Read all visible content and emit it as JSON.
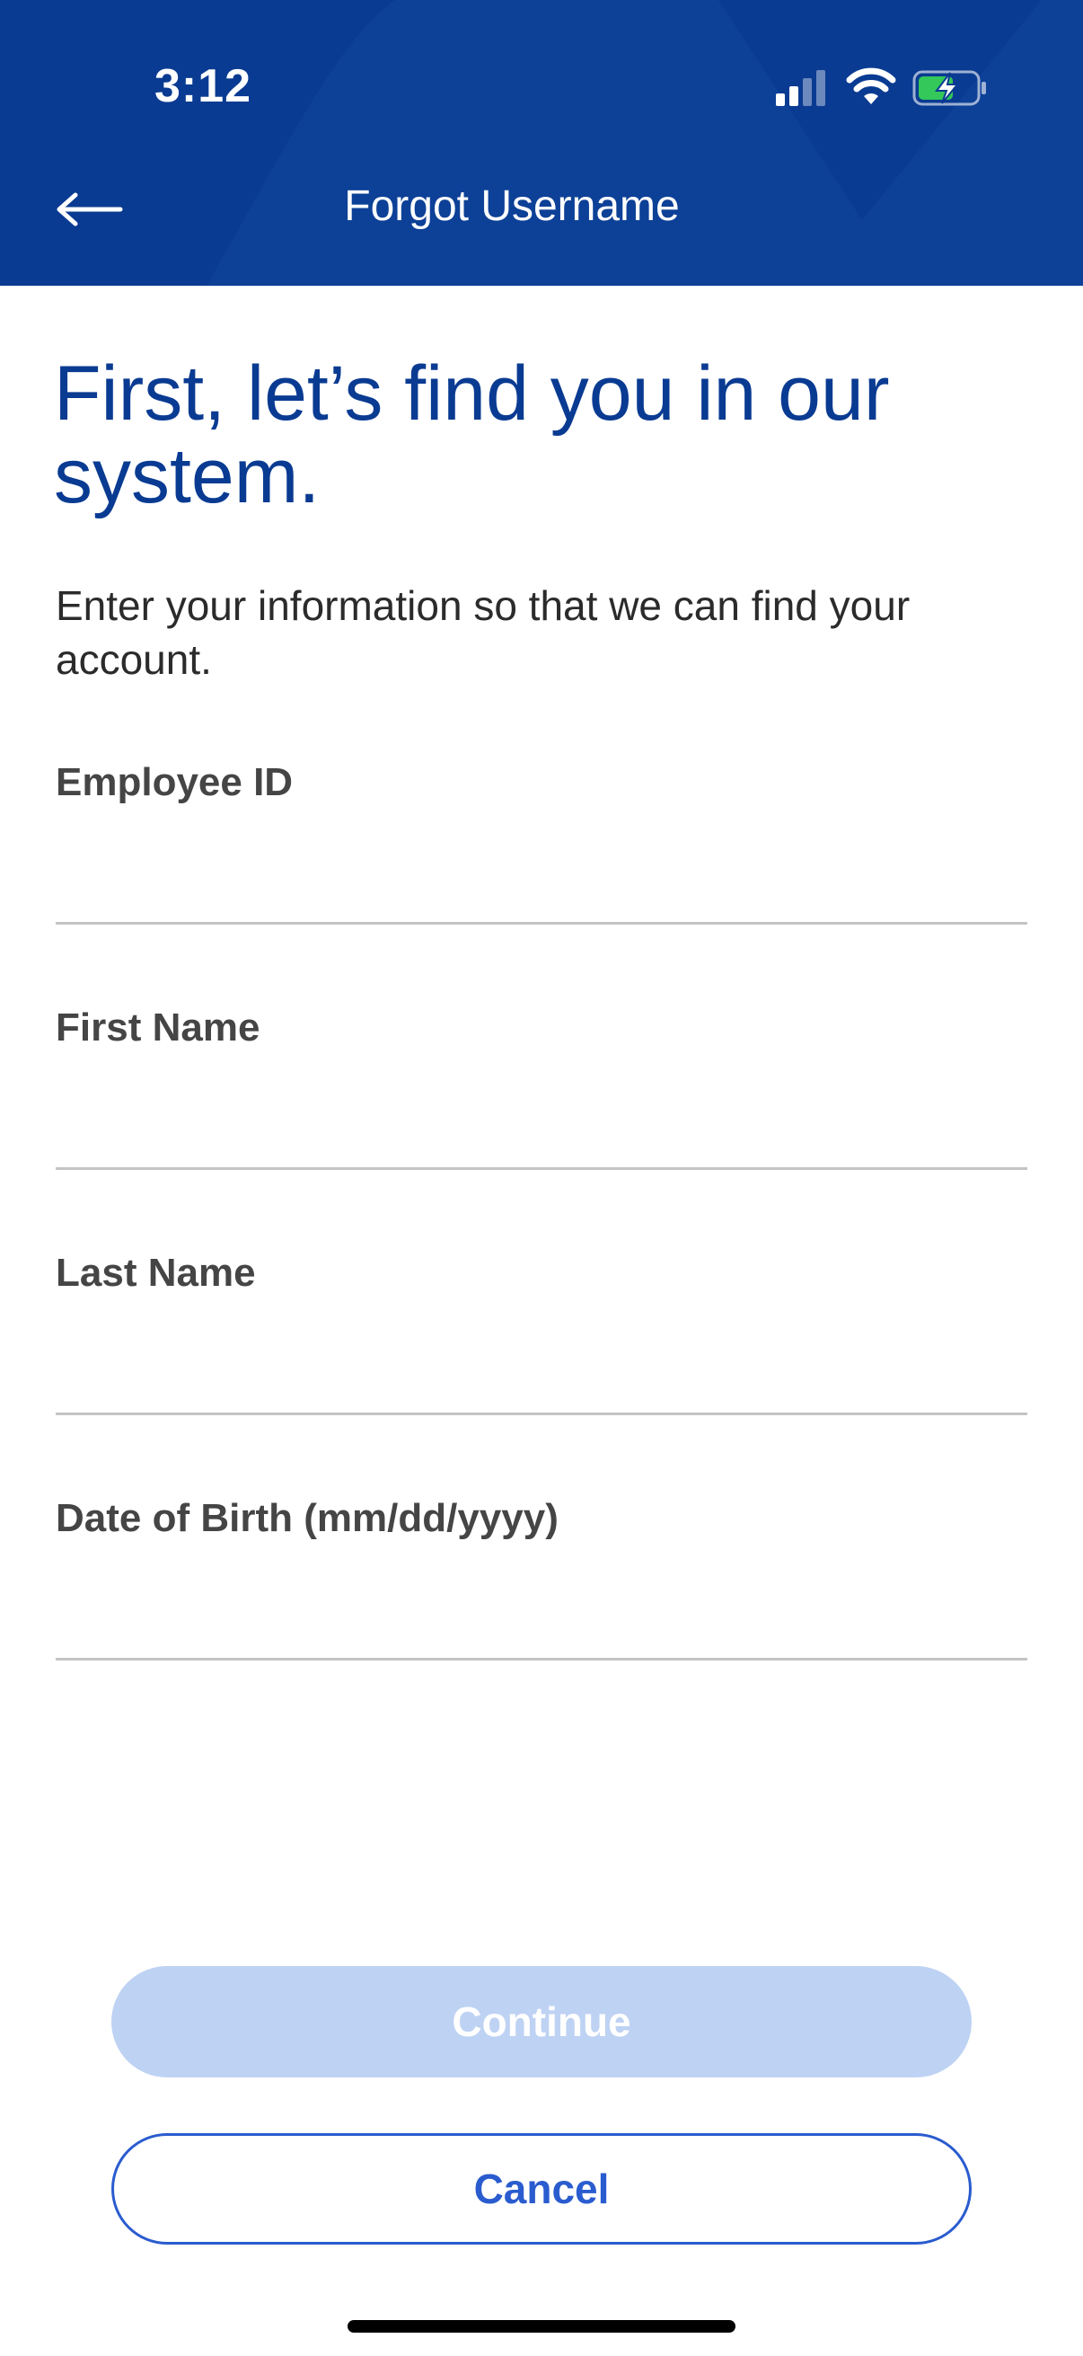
{
  "status_bar": {
    "time": "3:12",
    "icons": [
      "signal-icon",
      "wifi-icon",
      "battery-charging-icon"
    ],
    "battery_color": "#34c759"
  },
  "header": {
    "title": "Forgot Username",
    "back_icon": "arrow-left-icon",
    "background_color": "#0a3b92"
  },
  "main": {
    "headline": "First, let’s find you in our system.",
    "intro": "Enter your information so that we can find your account."
  },
  "form": {
    "fields": [
      {
        "label": "Employee ID",
        "value": "",
        "placeholder": ""
      },
      {
        "label": "First Name",
        "value": "",
        "placeholder": ""
      },
      {
        "label": "Last Name",
        "value": "",
        "placeholder": ""
      },
      {
        "label": "Date of Birth (mm/dd/yyyy)",
        "value": "",
        "placeholder": ""
      }
    ]
  },
  "actions": {
    "continue_label": "Continue",
    "continue_disabled": true,
    "cancel_label": "Cancel",
    "accent_color": "#2a5ccf"
  }
}
